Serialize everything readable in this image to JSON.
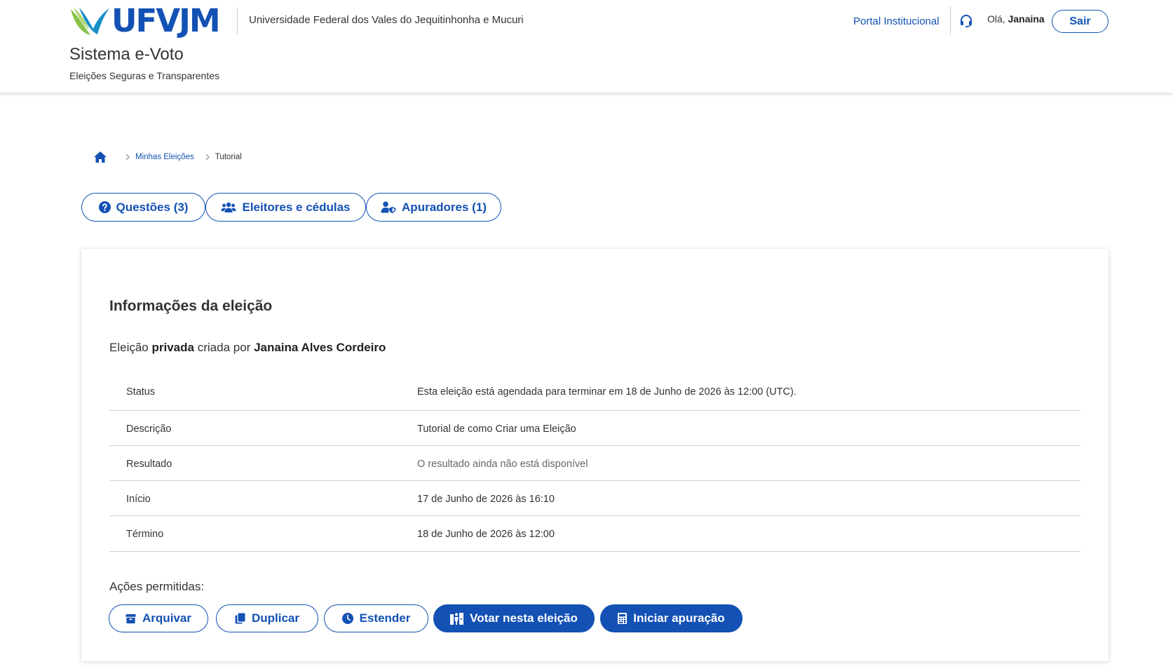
{
  "header": {
    "logo_text": "UFVJM",
    "university_name": "Universidade Federal dos Vales do Jequitinhonha e Mucuri",
    "system_title": "Sistema e-Voto",
    "system_subtitle": "Eleições Seguras e Transparentes",
    "portal_link": "Portal Institucional",
    "greeting_prefix": "Olá,",
    "user_name": "Janaina",
    "logout_label": "Sair",
    "icons": [
      "headset-icon"
    ]
  },
  "breadcrumb": {
    "home_icon": "home-icon",
    "items": [
      {
        "label": "Minhas Eleições"
      },
      {
        "label": "Tutorial"
      }
    ]
  },
  "tabs": [
    {
      "label": "Questões (3)",
      "icon": "question-circle-icon"
    },
    {
      "label": "Eleitores e cédulas",
      "icon": "users-icon"
    },
    {
      "label": "Apuradores (1)",
      "icon": "user-shield-icon"
    }
  ],
  "election": {
    "section_title": "Informações da eleição",
    "desc_prefix": "Eleição",
    "visibility": "privada",
    "desc_middle": "criada por",
    "creator": "Janaina Alves Cordeiro",
    "rows": [
      {
        "label": "Status",
        "value": "Esta eleição está agendada para terminar em 18 de Junho de 2026 às 12:00 (UTC)."
      },
      {
        "label": "Descrição",
        "value": "Tutorial de como Criar uma Eleição"
      },
      {
        "label": "Resultado",
        "value": "O resultado ainda não está disponível"
      },
      {
        "label": "Início",
        "value": "17 de Junho de 2026 às 16:10"
      },
      {
        "label": "Término",
        "value": "18 de Junho de 2026 às 12:00"
      }
    ]
  },
  "actions": {
    "title": "Ações permitidas:",
    "buttons": [
      {
        "label": "Arquivar",
        "icon": "archive-icon",
        "style": "secondary"
      },
      {
        "label": "Duplicar",
        "icon": "copy-icon",
        "style": "secondary"
      },
      {
        "label": "Estender",
        "icon": "clock-icon",
        "style": "secondary"
      },
      {
        "label": "Votar nesta eleição",
        "icon": "person-booth-icon",
        "style": "primary"
      },
      {
        "label": "Iniciar apuração",
        "icon": "calculator-icon",
        "style": "primary"
      }
    ]
  },
  "colors": {
    "primary": "#1351b4",
    "logo_leaf_green": "#8bc34a",
    "text": "#333333",
    "divider": "#cfcfcf"
  }
}
